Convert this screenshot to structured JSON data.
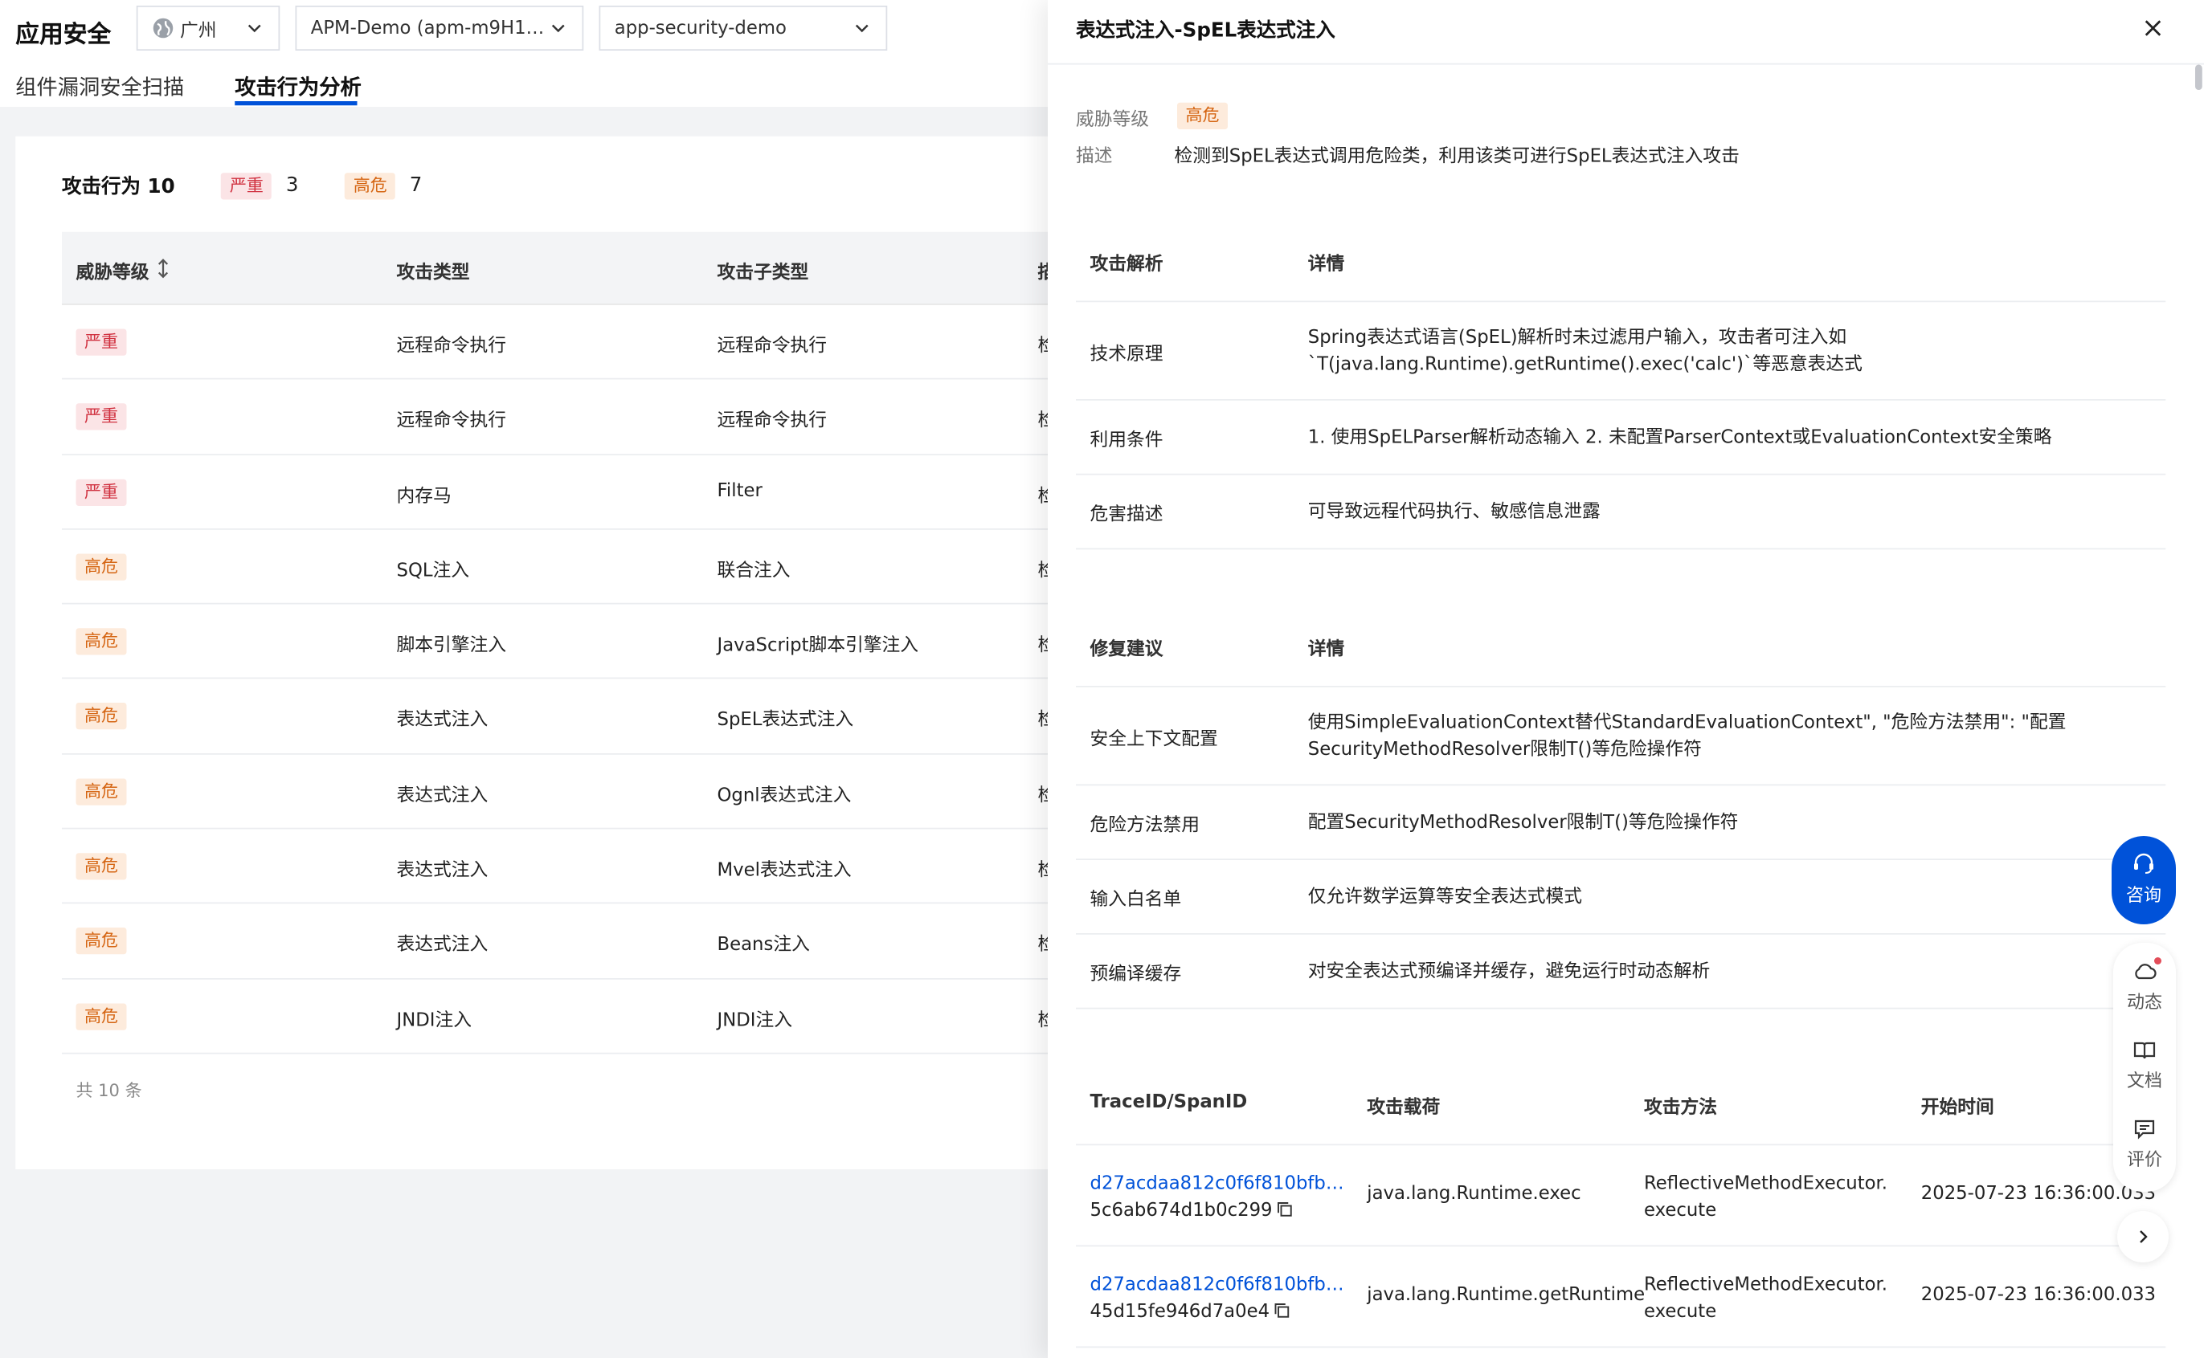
{
  "app": {
    "title": "应用安全"
  },
  "selectors": {
    "region": "广州",
    "apm_instance": "APM-Demo (apm-m9H16O…",
    "app": "app-security-demo"
  },
  "tabs": [
    {
      "label": "组件漏洞安全扫描"
    },
    {
      "label": "攻击行为分析"
    }
  ],
  "summary": {
    "label": "攻击行为 10",
    "critical_label": "严重",
    "critical_count": "3",
    "high_label": "高危",
    "high_count": "7"
  },
  "table": {
    "headers": {
      "level": "威胁等级",
      "type": "攻击类型",
      "subtype": "攻击子类型",
      "desc": "描"
    },
    "rows": [
      {
        "level": "严重",
        "severity": "critical",
        "type": "远程命令执行",
        "subtype": "远程命令执行",
        "desc": "检"
      },
      {
        "level": "严重",
        "severity": "critical",
        "type": "远程命令执行",
        "subtype": "远程命令执行",
        "desc": "检"
      },
      {
        "level": "严重",
        "severity": "critical",
        "type": "内存马",
        "subtype": "Filter",
        "desc": "检"
      },
      {
        "level": "高危",
        "severity": "high",
        "type": "SQL注入",
        "subtype": "联合注入",
        "desc": "检"
      },
      {
        "level": "高危",
        "severity": "high",
        "type": "脚本引擎注入",
        "subtype": "JavaScript脚本引擎注入",
        "desc": "检"
      },
      {
        "level": "高危",
        "severity": "high",
        "type": "表达式注入",
        "subtype": "SpEL表达式注入",
        "desc": "检"
      },
      {
        "level": "高危",
        "severity": "high",
        "type": "表达式注入",
        "subtype": "Ognl表达式注入",
        "desc": "检"
      },
      {
        "level": "高危",
        "severity": "high",
        "type": "表达式注入",
        "subtype": "Mvel表达式注入",
        "desc": "检"
      },
      {
        "level": "高危",
        "severity": "high",
        "type": "表达式注入",
        "subtype": "Beans注入",
        "desc": "检"
      },
      {
        "level": "高危",
        "severity": "high",
        "type": "JNDI注入",
        "subtype": "JNDI注入",
        "desc": "检"
      }
    ],
    "total": "共 10 条"
  },
  "drawer": {
    "title": "表达式注入-SpEL表达式注入",
    "level_label": "威胁等级",
    "level_value": "高危",
    "desc_label": "描述",
    "desc_value": "检测到SpEL表达式调用危险类，利用该类可进行SpEL表达式注入攻击",
    "analysis": {
      "header_key": "攻击解析",
      "header_val": "详情",
      "rows": [
        {
          "k": "技术原理",
          "v": "Spring表达式语言(SpEL)解析时未过滤用户输入，攻击者可注入如`T(java.lang.Runtime).getRuntime().exec('calc')`等恶意表达式"
        },
        {
          "k": "利用条件",
          "v": "1. 使用SpELParser解析动态输入 2. 未配置ParserContext或EvaluationContext安全策略"
        },
        {
          "k": "危害描述",
          "v": "可导致远程代码执行、敏感信息泄露"
        }
      ]
    },
    "fix": {
      "header_key": "修复建议",
      "header_val": "详情",
      "rows": [
        {
          "k": "安全上下文配置",
          "v": "使用SimpleEvaluationContext替代StandardEvaluationContext\", \"危险方法禁用\": \"配置SecurityMethodResolver限制T()等危险操作符"
        },
        {
          "k": "危险方法禁用",
          "v": "配置SecurityMethodResolver限制T()等危险操作符"
        },
        {
          "k": "输入白名单",
          "v": "仅允许数学运算等安全表达式模式"
        },
        {
          "k": "预编译缓存",
          "v": "对安全表达式预编译并缓存，避免运行时动态解析"
        }
      ]
    },
    "traces": {
      "headers": {
        "id": "TraceID/SpanID",
        "payload": "攻击载荷",
        "method": "攻击方法",
        "time": "开始时间"
      },
      "rows": [
        {
          "trace": "d27acdaa812c0f6f810bfb…",
          "span": "5c6ab674d1b0c299",
          "payload": "java.lang.Runtime.exec",
          "method": "ReflectiveMethodExecutor.execute",
          "time": "2025-07-23 16:36:00.033"
        },
        {
          "trace": "d27acdaa812c0f6f810bfb…",
          "span": "45d15fe946d7a0e4",
          "payload": "java.lang.Runtime.getRuntime",
          "method": "ReflectiveMethodExecutor.execute",
          "time": "2025-07-23 16:36:00.033"
        }
      ]
    }
  },
  "side": {
    "consult": "咨询",
    "news": "动态",
    "docs": "文档",
    "rate": "评价"
  },
  "colors": {
    "accent": "#0052d9",
    "critical": "#d0303f",
    "high": "#d56512"
  }
}
